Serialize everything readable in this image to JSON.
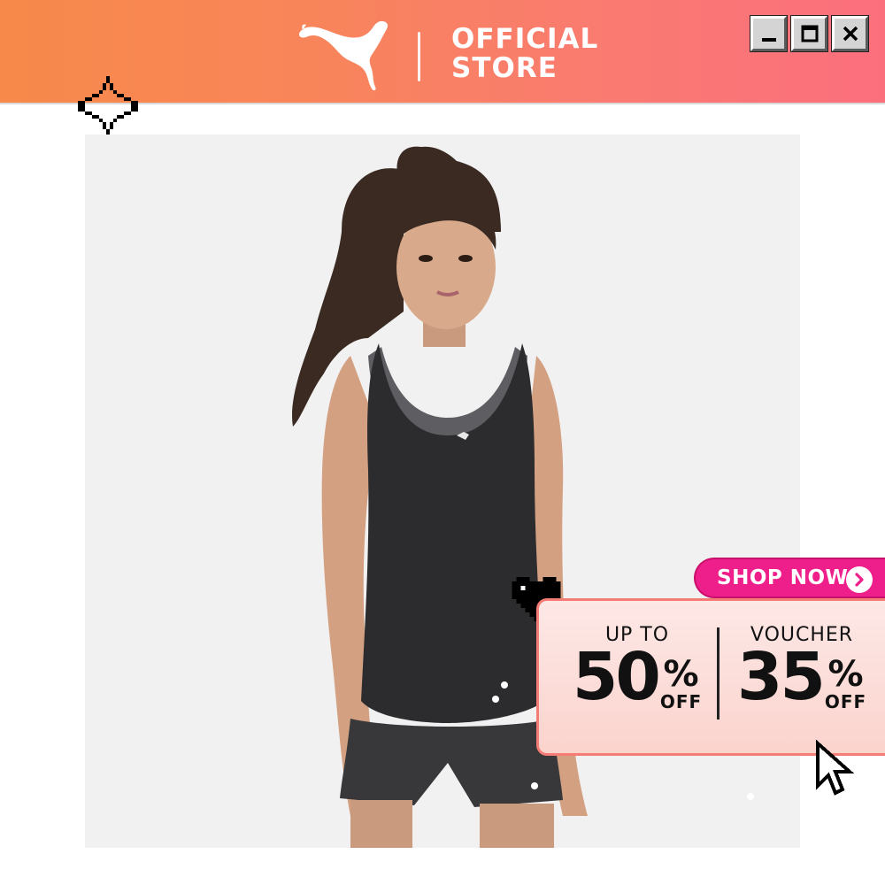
{
  "header": {
    "brand_icon": "puma-cat-logo-icon",
    "store_line1": "OFFICIAL",
    "store_line2": "STORE",
    "window_buttons": [
      "minimize-icon",
      "maximize-icon",
      "close-icon"
    ]
  },
  "promo": {
    "shop_label": "SHOP NOW",
    "shop_icon": "chevron-right-icon",
    "discount": {
      "top": "UP TO",
      "number": "50",
      "percent": "%",
      "off": "OFF"
    },
    "voucher": {
      "top": "VOUCHER",
      "number": "35",
      "percent": "%",
      "off": "OFF"
    }
  },
  "decor": {
    "sparkle_icon": "pixel-sparkle-icon",
    "heart_icon": "pixel-heart-icon",
    "cursor_icon": "pixel-cursor-icon"
  },
  "colors": {
    "header_gradient_start": "#f7894a",
    "header_gradient_end": "#fb6f7d",
    "shop_pill": "#ee1f8a",
    "promo_border": "#f47c74"
  }
}
